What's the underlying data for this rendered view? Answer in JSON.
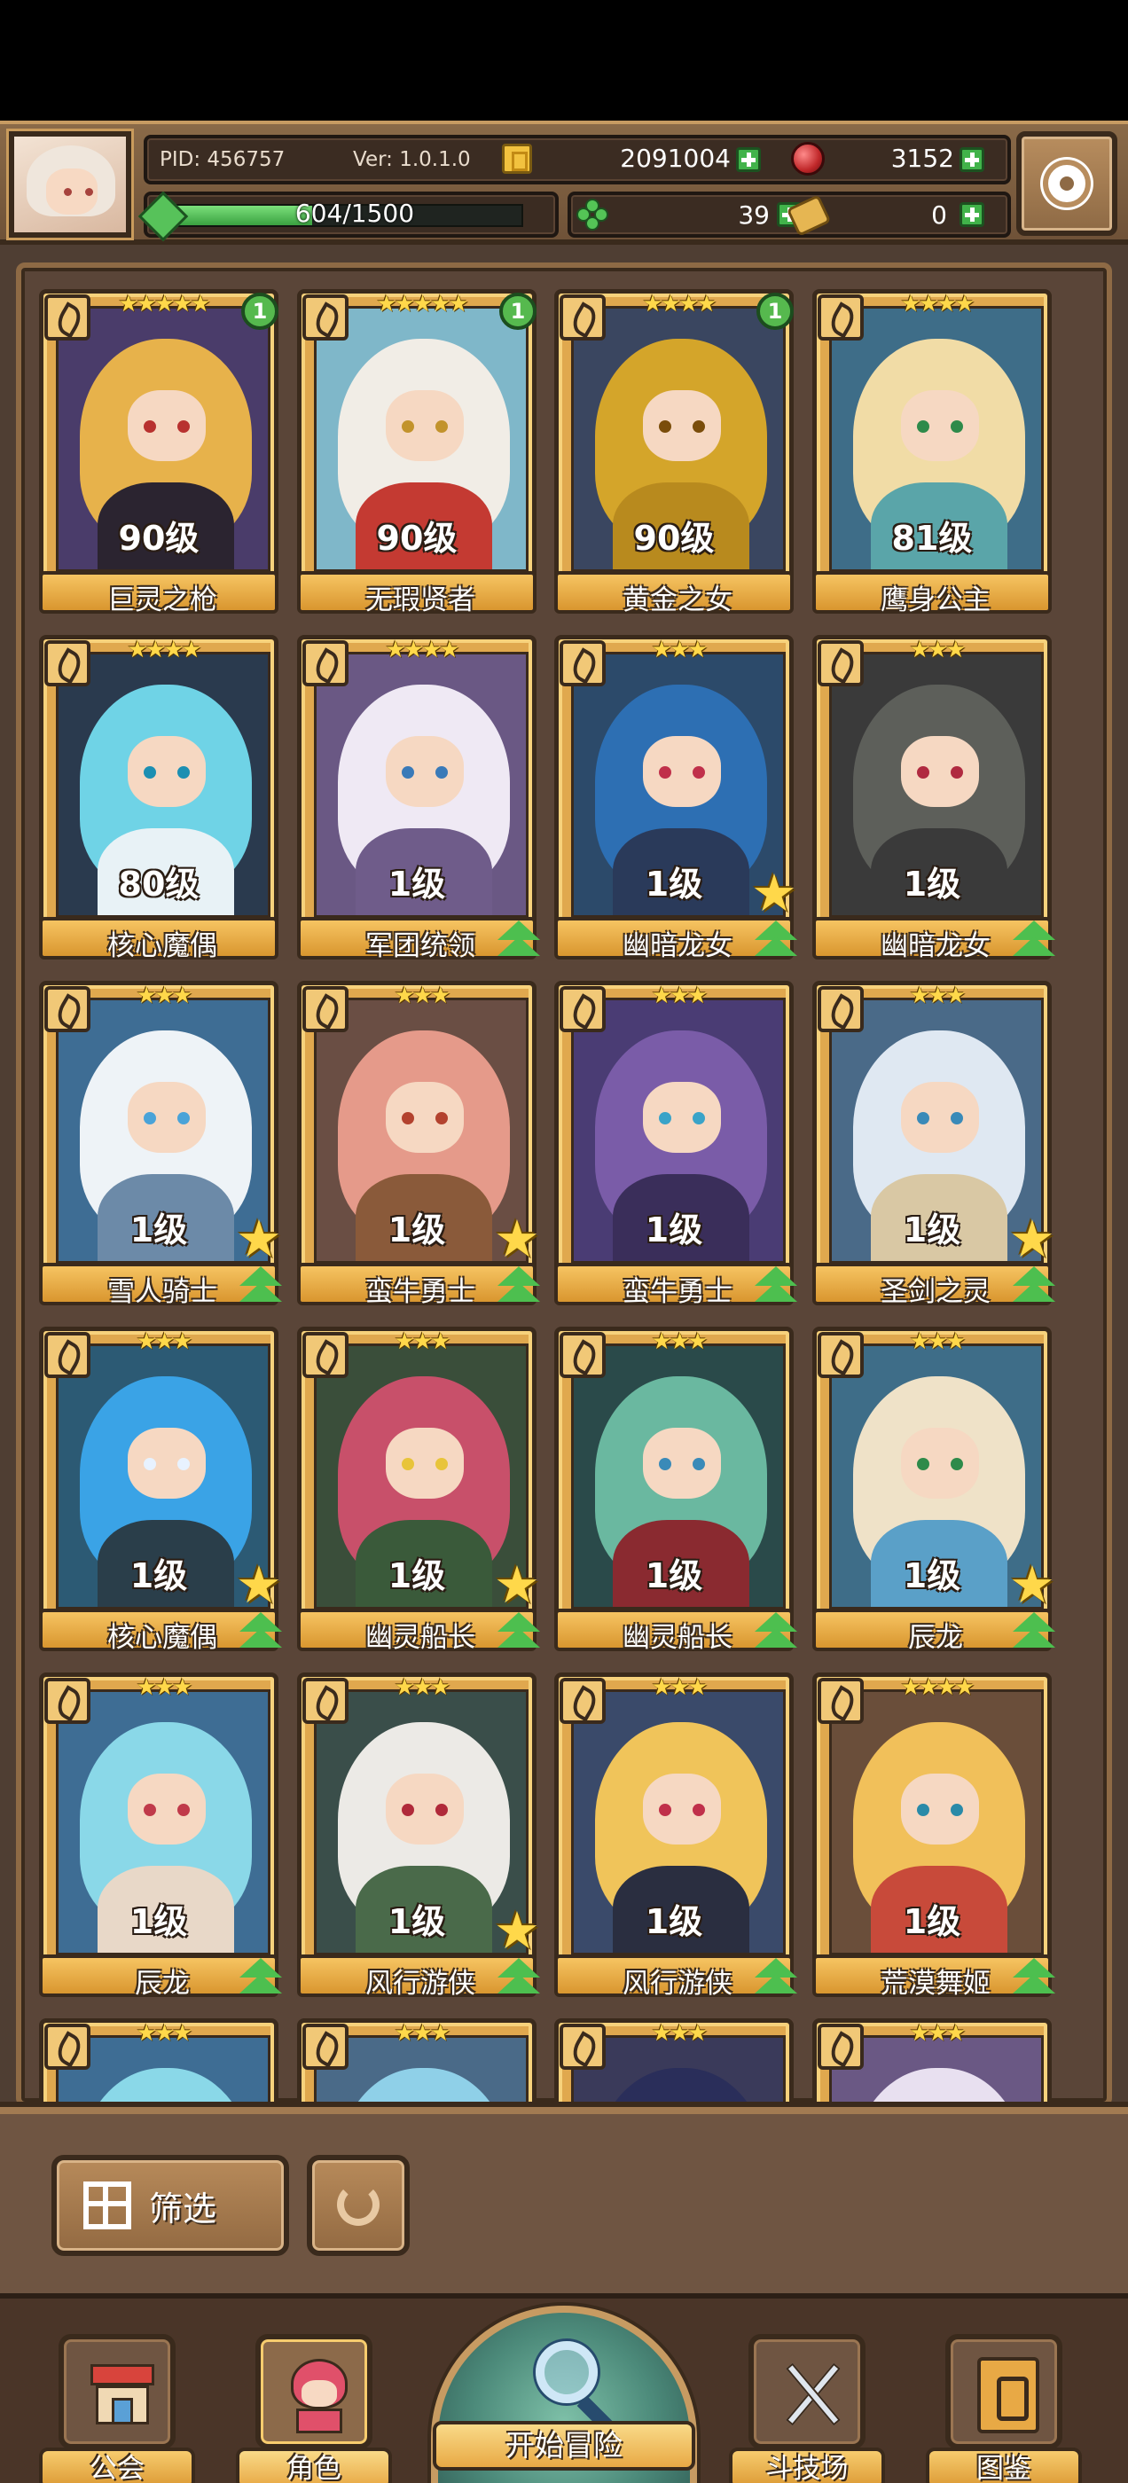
{
  "header": {
    "pid": "PID: 456757",
    "version": "Ver: 1.0.1.0",
    "gold": "2091004",
    "gems": "3152",
    "xp": "604/1500",
    "xp_fraction": 0.403,
    "clover": "39",
    "tickets": "0"
  },
  "cards": [
    {
      "name": "巨灵之枪",
      "level": "90级",
      "stars": "★★★★★",
      "badge": "1",
      "up": false,
      "star": false,
      "hair": "#e7b24b",
      "body": "#2b2430",
      "bg": "#4a3c6a",
      "eye": "#b8312f"
    },
    {
      "name": "无瑕贤者",
      "level": "90级",
      "stars": "★★★★★",
      "badge": "1",
      "up": false,
      "star": false,
      "hair": "#f1ede6",
      "body": "#c43a32",
      "bg": "#7fb7c9",
      "eye": "#c2932c"
    },
    {
      "name": "黄金之女",
      "level": "90级",
      "stars": "★★★★",
      "badge": "1",
      "up": false,
      "star": false,
      "hair": "#d4a52a",
      "body": "#b88a1e",
      "bg": "#3a4660",
      "eye": "#7a4d0a"
    },
    {
      "name": "鹰身公主",
      "level": "81级",
      "stars": "★★★★",
      "badge": "",
      "up": false,
      "star": false,
      "hair": "#f1dca6",
      "body": "#5aa5a9",
      "bg": "#3e6d88",
      "eye": "#2e8a4a"
    },
    {
      "name": "核心魔偶",
      "level": "80级",
      "stars": "★★★★",
      "badge": "",
      "up": false,
      "star": false,
      "hair": "#6fd3e6",
      "body": "#e8f2f6",
      "bg": "#2a3a4e",
      "eye": "#1c8fb2"
    },
    {
      "name": "军团统领",
      "level": "1级",
      "stars": "★★★★",
      "badge": "",
      "up": true,
      "star": false,
      "hair": "#efe9f4",
      "body": "#6f5c8a",
      "bg": "#6a5884",
      "eye": "#3a7ab8"
    },
    {
      "name": "幽暗龙女",
      "level": "1级",
      "stars": "★★★",
      "badge": "",
      "up": true,
      "star": true,
      "hair": "#2d6fb3",
      "body": "#2a3a5a",
      "bg": "#2c4a6a",
      "eye": "#c0304a"
    },
    {
      "name": "幽暗龙女",
      "level": "1级",
      "stars": "★★★",
      "badge": "",
      "up": true,
      "star": false,
      "hair": "#5d5f5a",
      "body": "#3a3a3a",
      "bg": "#3a3a3a",
      "eye": "#b02a40"
    },
    {
      "name": "雪人骑士",
      "level": "1级",
      "stars": "★★★",
      "badge": "",
      "up": true,
      "star": true,
      "hair": "#eef3f7",
      "body": "#6c8aa8",
      "bg": "#3e6d94",
      "eye": "#4aa3d8"
    },
    {
      "name": "蛮牛勇士",
      "level": "1级",
      "stars": "★★★",
      "badge": "",
      "up": true,
      "star": true,
      "hair": "#e59a8a",
      "body": "#8a5a3a",
      "bg": "#6a4e44",
      "eye": "#b3422e"
    },
    {
      "name": "蛮牛勇士",
      "level": "1级",
      "stars": "★★★",
      "badge": "",
      "up": true,
      "star": false,
      "hair": "#7a5ca8",
      "body": "#3a2e5a",
      "bg": "#4a3c74",
      "eye": "#3aa3c8"
    },
    {
      "name": "圣剑之灵",
      "level": "1级",
      "stars": "★★★",
      "badge": "",
      "up": true,
      "star": true,
      "hair": "#dfe8f2",
      "body": "#d9c8a4",
      "bg": "#4a6a88",
      "eye": "#3a8ab8"
    },
    {
      "name": "核心魔偶",
      "level": "1级",
      "stars": "★★★",
      "badge": "",
      "up": true,
      "star": true,
      "hair": "#3aa3e6",
      "body": "#2a3e4a",
      "bg": "#2c5a74",
      "eye": "#e8f2ff"
    },
    {
      "name": "幽灵船长",
      "level": "1级",
      "stars": "★★★",
      "badge": "",
      "up": true,
      "star": true,
      "hair": "#c8506a",
      "body": "#3a5a3a",
      "bg": "#3a4e3a",
      "eye": "#e8c43a"
    },
    {
      "name": "幽灵船长",
      "level": "1级",
      "stars": "★★★",
      "badge": "",
      "up": true,
      "star": false,
      "hair": "#6ab8a0",
      "body": "#8a2a30",
      "bg": "#2a4a4a",
      "eye": "#3a8ab8"
    },
    {
      "name": "辰龙",
      "level": "1级",
      "stars": "★★★",
      "badge": "",
      "up": true,
      "star": true,
      "hair": "#efe2c8",
      "body": "#5aa0c8",
      "bg": "#3e6d88",
      "eye": "#2e8a4a"
    },
    {
      "name": "辰龙",
      "level": "1级",
      "stars": "★★★",
      "badge": "",
      "up": true,
      "star": false,
      "hair": "#8ad8e8",
      "body": "#e8d8c8",
      "bg": "#3e6d94",
      "eye": "#c03a4a"
    },
    {
      "name": "风行游侠",
      "level": "1级",
      "stars": "★★★",
      "badge": "",
      "up": true,
      "star": true,
      "hair": "#eceae6",
      "body": "#4a6a4a",
      "bg": "#3a4e4a",
      "eye": "#b02a3a"
    },
    {
      "name": "风行游侠",
      "level": "1级",
      "stars": "★★★",
      "badge": "",
      "up": true,
      "star": false,
      "hair": "#f0c45a",
      "body": "#2a2e40",
      "bg": "#3a4a6a",
      "eye": "#c0304a"
    },
    {
      "name": "荒漠舞姬",
      "level": "1级",
      "stars": "★★★★",
      "badge": "",
      "up": true,
      "star": false,
      "hair": "#f1c05a",
      "body": "#c84a3a",
      "bg": "#6a4e3a",
      "eye": "#2a8aa8"
    }
  ],
  "partial_row": [
    {
      "stars": "★★★",
      "hair": "#8ad8e8",
      "bg": "#3e6d94"
    },
    {
      "stars": "★★★",
      "hair": "#8fd0e8",
      "bg": "#4a6a88"
    },
    {
      "stars": "★★★",
      "hair": "#2a2e5a",
      "bg": "#3a3a5a"
    },
    {
      "stars": "★★★",
      "hair": "#e8e0f0",
      "bg": "#6a5884"
    }
  ],
  "controls": {
    "filter_label": "筛选"
  },
  "nav": {
    "guild": "公会",
    "characters": "角色",
    "adventure": "开始冒险",
    "arena": "斗技场",
    "codex": "图鉴"
  }
}
